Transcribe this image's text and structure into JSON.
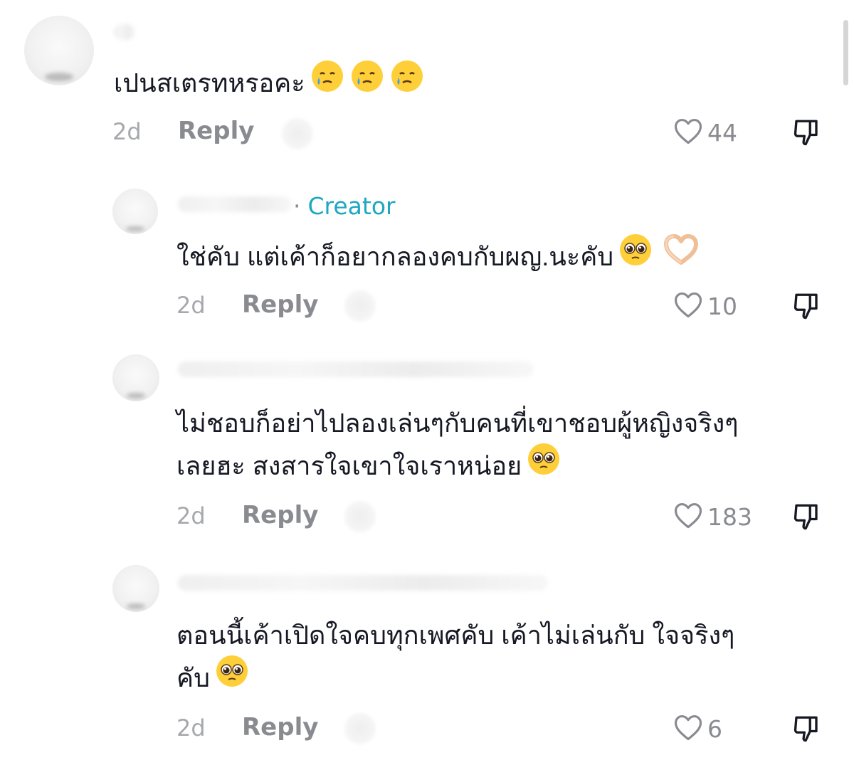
{
  "comments": [
    {
      "text_lines": [
        "เปนสเตรทหรอคะ"
      ],
      "emojis": [
        "crying-face",
        "crying-face",
        "crying-face"
      ],
      "time": "2d",
      "reply_label": "Reply",
      "likes": "44"
    },
    {
      "creator_label": "Creator",
      "creator_separator": "·",
      "text_lines": [
        "ใช่คับ แต่เค้าก็อยากลองคบกับผญ.นะคับ"
      ],
      "emojis": [
        "pleading-face",
        "heart-hands"
      ],
      "time": "2d",
      "reply_label": "Reply",
      "likes": "10"
    },
    {
      "text_lines": [
        "ไม่ชอบก็อย่าไปลองเล่นๆกับคนที่เขาชอบผู้หญิงจริงๆ",
        "เลยฮะ สงสารใจเขาใจเราหน่อย"
      ],
      "emojis": [
        "pleading-face"
      ],
      "time": "2d",
      "reply_label": "Reply",
      "likes": "183"
    },
    {
      "text_lines": [
        "ตอนนี้เค้าเปิดใจคบทุกเพศคับ เค้าไม่เล่นกับ ใจจริงๆ",
        "คับ"
      ],
      "emojis": [
        "pleading-face"
      ],
      "time": "2d",
      "reply_label": "Reply",
      "likes": "6"
    }
  ],
  "colors": {
    "text": "#161823",
    "meta": "#8a8b91",
    "creator": "#1ea7c0",
    "emoji_yellow": "#ffcf3a",
    "tear_blue": "#3aa0e8"
  }
}
